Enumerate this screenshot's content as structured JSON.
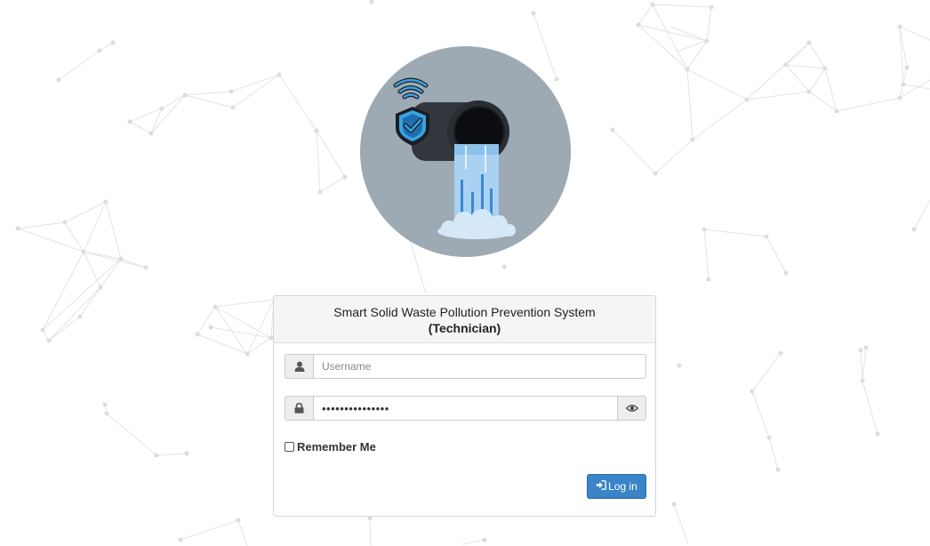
{
  "logo": {
    "icon": "waste-pipe-shield-wifi-icon",
    "circle_color": "#9daab4"
  },
  "panel": {
    "title": "Smart Solid Waste Pollution Prevention System",
    "subtitle": "(Technician)"
  },
  "username": {
    "icon": "user-icon",
    "placeholder": "Username",
    "value": ""
  },
  "password": {
    "icon": "lock-icon",
    "value": "•••••••••••••••",
    "toggle_icon": "eye-icon"
  },
  "remember": {
    "label": "Remember Me",
    "checked": false
  },
  "login_button": {
    "icon": "sign-in-icon",
    "label": "Log in",
    "color": "#3a84c8"
  },
  "colors": {
    "background": "#ffffff",
    "network_lines": "#e2e2e2"
  }
}
